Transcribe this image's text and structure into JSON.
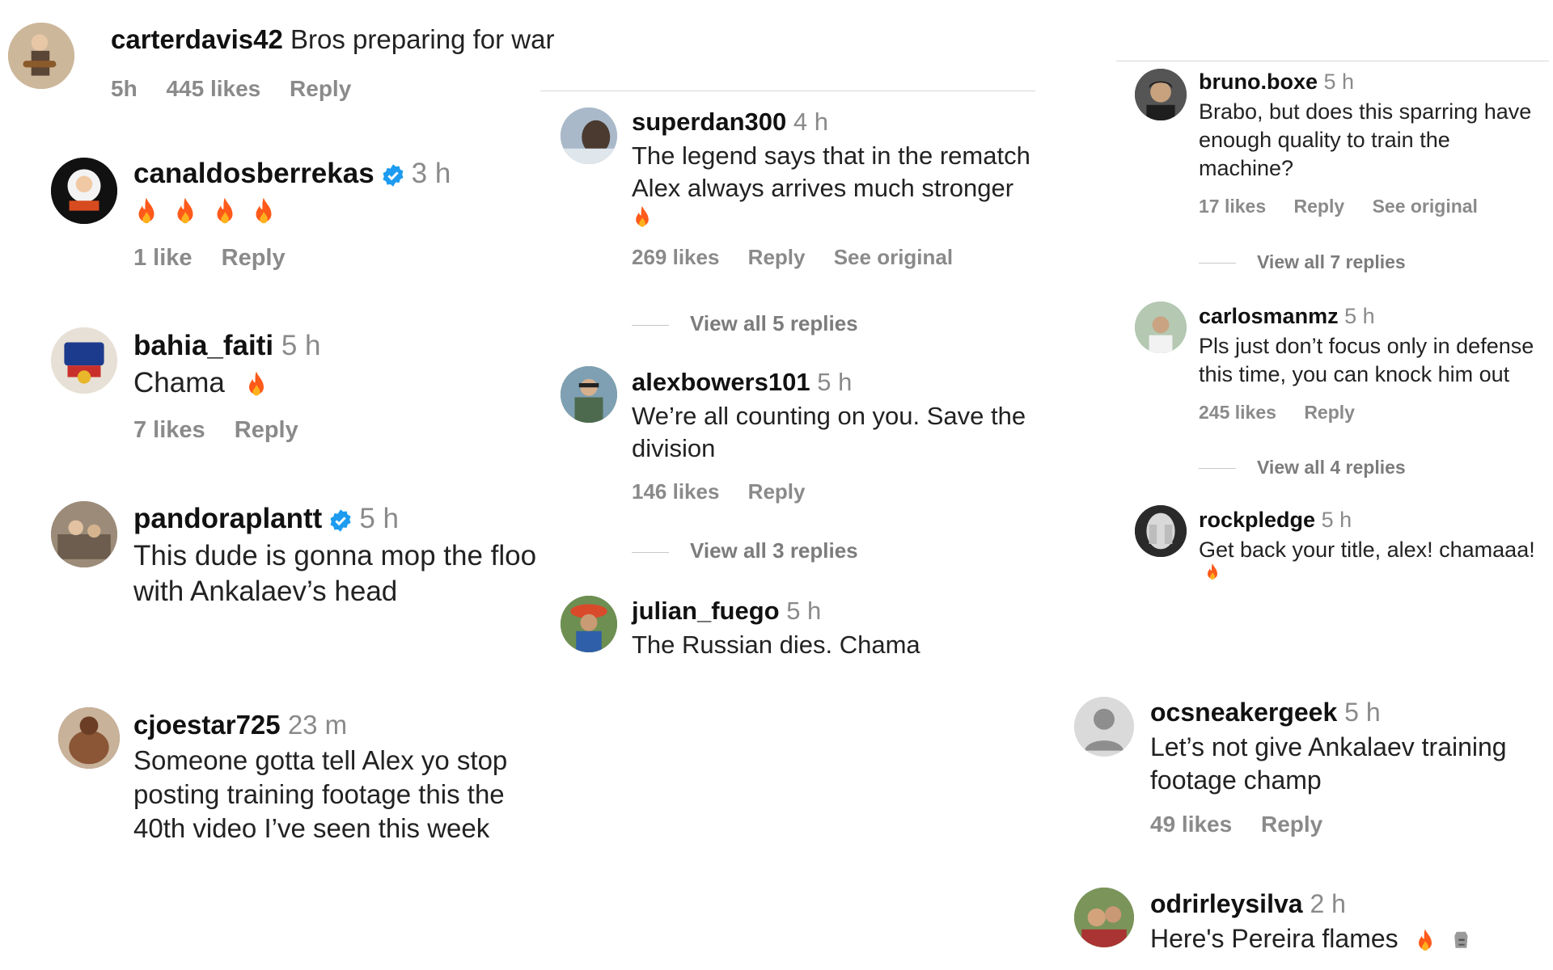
{
  "colors": {
    "username": "#111111",
    "muted": "#8a8a8a",
    "verified": "#1d9bf0",
    "flame": "#ff5a1a"
  },
  "col1": [
    {
      "user": "carterdavis42",
      "text": "Bros preparing for war",
      "time": "5h",
      "likes": "445 likes",
      "reply": "Reply"
    },
    {
      "user": "canaldosberrekas",
      "verified": true,
      "time": "3 h",
      "emoji": "flame x4",
      "likes": "1 like",
      "reply": "Reply"
    },
    {
      "user": "bahia_faiti",
      "time": "5 h",
      "text": "Chama",
      "emoji": "flame",
      "likes": "7 likes",
      "reply": "Reply"
    },
    {
      "user": "pandoraplantt",
      "verified": true,
      "time": "5 h",
      "line1": "This dude is gonna mop the floo",
      "line2": "with Ankalaev’s head"
    },
    {
      "user": "cjoestar725",
      "time": "23 m",
      "line1": "Someone gotta tell Alex yo stop",
      "line2": "posting training footage this the",
      "line3": "40th video I’ve seen this week"
    }
  ],
  "col2": [
    {
      "user": "superdan300",
      "time": "4 h",
      "line1": "The legend says that in the rematch",
      "line2": "Alex always arrives much stronger",
      "emoji": "flame",
      "likes": "269 likes",
      "reply": "Reply",
      "see_original": "See original",
      "view_replies": "View all 5 replies"
    },
    {
      "user": "alexbowers101",
      "time": "5 h",
      "line1": "We’re all counting on you. Save the",
      "line2": "division",
      "likes": "146 likes",
      "reply": "Reply",
      "view_replies": "View all 3 replies"
    },
    {
      "user": "julian_fuego",
      "time": "5 h",
      "text": "The Russian dies. Chama"
    }
  ],
  "col3": [
    {
      "user": "bruno.boxe",
      "time": "5 h",
      "line1": "Brabo, but does this sparring have",
      "line2": "enough quality to train the",
      "line3": "machine?",
      "likes": "17 likes",
      "reply": "Reply",
      "see_original": "See original",
      "view_replies": "View all 7 replies"
    },
    {
      "user": "carlosmanmz",
      "time": "5 h",
      "line1": "Pls just don’t focus only in defense",
      "line2": "this time, you can knock him out",
      "likes": "245 likes",
      "reply": "Reply",
      "view_replies": "View all 4 replies"
    },
    {
      "user": "rockpledge",
      "time": "5 h",
      "text": "Get back your title, alex! chamaaa!",
      "emoji": "flame"
    },
    {
      "user": "ocsneakergeek",
      "time": "5 h",
      "line1": "Let’s not give Ankalaev training",
      "line2": "footage champ",
      "likes": "49 likes",
      "reply": "Reply"
    },
    {
      "user": "odrirleysilva",
      "time": "2 h",
      "text": "Here's Pereira flames",
      "emoji": "flame, moai"
    }
  ]
}
